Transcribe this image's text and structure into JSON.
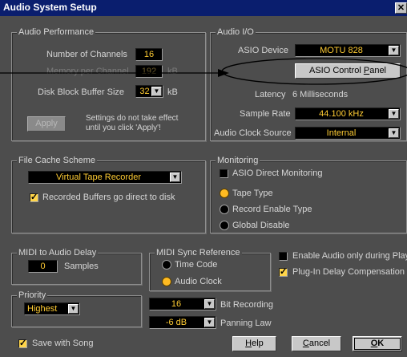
{
  "window": {
    "title": "Audio System Setup",
    "close_glyph": "✕"
  },
  "performance": {
    "legend": "Audio Performance",
    "channels_label": "Number of Channels",
    "channels_value": "16",
    "memory_label": "Memory per Channel",
    "memory_value": "192",
    "memory_unit": "kB",
    "disk_label": "Disk Block Buffer Size",
    "disk_value": "32",
    "disk_unit": "kB",
    "apply_label": "Apply",
    "apply_note_line1": "Settings do not take effect",
    "apply_note_line2": "until you click 'Apply'!"
  },
  "audio_io": {
    "legend": "Audio I/O",
    "asio_device_label": "ASIO Device",
    "asio_device_value": "MOTU 828",
    "control_panel_prefix": "ASIO Control ",
    "control_panel_key": "P",
    "control_panel_suffix": "anel",
    "latency_label": "Latency",
    "latency_value": "6 Milliseconds",
    "sample_rate_label": "Sample Rate",
    "sample_rate_value": "44.100 kHz",
    "clock_source_label": "Audio Clock Source",
    "clock_source_value": "Internal"
  },
  "file_cache": {
    "legend": "File Cache Scheme",
    "scheme_value": "Virtual Tape Recorder",
    "recorded_buffers_label": "Recorded Buffers go direct to disk",
    "recorded_buffers_checked": true
  },
  "monitoring": {
    "legend": "Monitoring",
    "asio_direct_label": "ASIO Direct Monitoring",
    "asio_direct_checked": false,
    "options": [
      {
        "label": "Tape Type",
        "selected": true
      },
      {
        "label": "Record Enable Type",
        "selected": false
      },
      {
        "label": "Global Disable",
        "selected": false
      }
    ]
  },
  "midi_delay": {
    "legend": "MIDI to Audio Delay",
    "value": "0",
    "unit": "Samples"
  },
  "midi_sync": {
    "legend": "MIDI Sync Reference",
    "options": [
      {
        "label": "Time Code",
        "selected": false
      },
      {
        "label": "Audio Clock",
        "selected": true
      }
    ]
  },
  "options_right": {
    "enable_audio_label": "Enable Audio only during Play",
    "enable_audio_checked": false,
    "plugin_delay_label": "Plug-In Delay Compensation",
    "plugin_delay_checked": true
  },
  "priority": {
    "legend": "Priority",
    "value": "Highest"
  },
  "bit_recording": {
    "value": "16",
    "label": "Bit Recording"
  },
  "panning": {
    "value": "-6 dB",
    "label": "Panning Law"
  },
  "save_with_song": {
    "label": "Save with Song",
    "checked": true
  },
  "buttons": {
    "help_key": "H",
    "help_rest": "elp",
    "cancel_key": "C",
    "cancel_rest": "ancel",
    "ok_key": "O",
    "ok_rest": "K"
  },
  "colors": {
    "panel": "#4d4d4d",
    "titlebar": "#0a1e6e",
    "field_bg": "#000000",
    "field_text": "#ffcc33",
    "radio_on": "#ffbb22",
    "checkbox_on": "#ffd54a"
  }
}
